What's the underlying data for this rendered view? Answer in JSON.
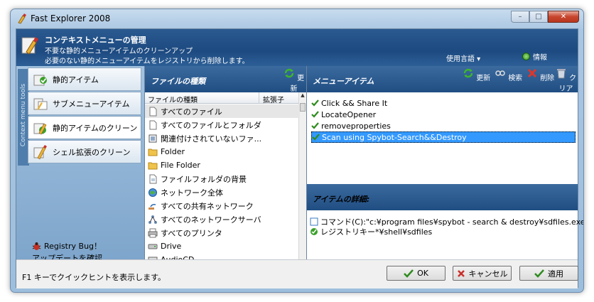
{
  "window": {
    "title": "Fast Explorer 2008",
    "controls": {
      "minimize": "–",
      "maximize": "□",
      "close": "✕"
    }
  },
  "header": {
    "title": "コンテキストメニューの管理",
    "subtitle1": "不要な静的メニューアイテムのクリーンアップ",
    "subtitle2": "必要のない静的メニューアイテムをレジストリから削除します。",
    "language": "使用言語 ▾",
    "info": "情報"
  },
  "sidebar": {
    "vertical_label": "Context menu tools",
    "items": [
      {
        "label": "静的アイテム",
        "icon": "static-items-icon"
      },
      {
        "label": "サブメニューアイテム",
        "icon": "submenu-icon"
      },
      {
        "label": "静的アイテムのクリーン",
        "icon": "clean-static-icon"
      },
      {
        "label": "シェル拡張のクリーン",
        "icon": "clean-shell-icon"
      }
    ],
    "registry_bug": "Registry Bug！",
    "check_update": "アップデートを確認"
  },
  "filetypes": {
    "section_title": "ファイルの種類",
    "refresh_label": "更新",
    "col_type": "ファイルの種類",
    "col_ext": "拡張子",
    "items": [
      {
        "label": "すべてのファイル",
        "icon": "file-icon"
      },
      {
        "label": "すべてのファイルとフォルダ",
        "icon": "file-icon"
      },
      {
        "label": "関連付けされていないファ...",
        "icon": "unknown-file-icon"
      },
      {
        "label": "Folder",
        "icon": "folder-icon"
      },
      {
        "label": "File Folder",
        "icon": "folder-icon"
      },
      {
        "label": "ファイルフォルダの背景",
        "icon": "folder-background-icon"
      },
      {
        "label": "ネットワーク全体",
        "icon": "network-icon"
      },
      {
        "label": "すべての共有ネットワーク",
        "icon": "share-icon"
      },
      {
        "label": "すべてのネットワークサーバ",
        "icon": "server-icon"
      },
      {
        "label": "すべてのプリンタ",
        "icon": "printer-icon"
      },
      {
        "label": "Drive",
        "icon": "drive-icon"
      },
      {
        "label": "AudioCD",
        "icon": "cd-icon"
      }
    ]
  },
  "menu_items": {
    "section_title": "メニューアイテム",
    "tools": {
      "refresh": "更新",
      "search": "検索",
      "delete": "削除",
      "clear": "クリア"
    },
    "items": [
      "Click && Share It",
      "LocateOpener",
      "removeproperties",
      "Scan using Spybot-Search&&Destroy"
    ]
  },
  "details": {
    "section_title": "アイテムの詳細:",
    "command": "コマンド(C):\"c:¥program files¥spybot - search & destroy¥sdfiles.exe\" \"",
    "registry_key": "レジストリキー*¥shell¥sdfiles"
  },
  "statusbar": {
    "hint": "F1 キーでクイックヒントを表示します。",
    "ok": "OK",
    "cancel": "キャンセル",
    "apply": "適用"
  },
  "colors": {
    "header_blue": "#1d4a80",
    "selection": "#3399ff",
    "check_green": "#2e8b1e"
  }
}
